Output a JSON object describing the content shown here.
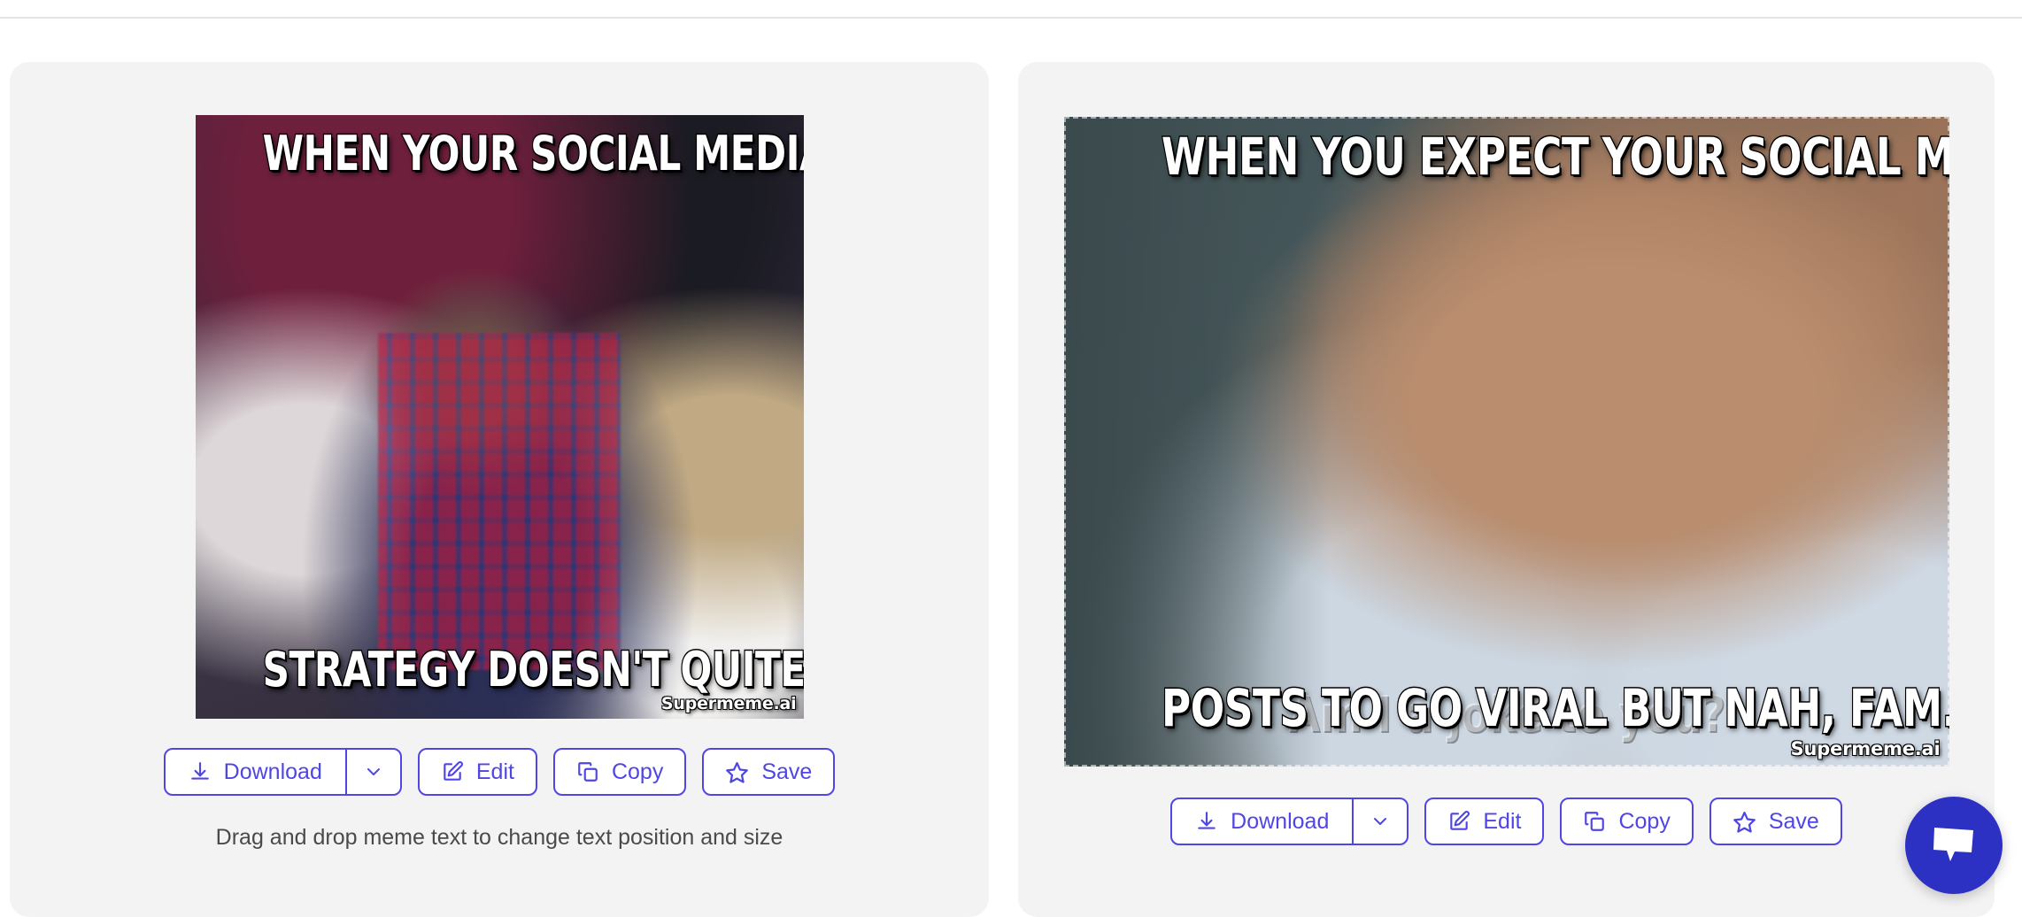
{
  "app": {
    "watermark": "Supermeme.ai",
    "accent_color": "#4f46e5",
    "chat_color": "#2c31c4",
    "card_background": "#f3f3f4",
    "page_background": "#ffffff"
  },
  "hint": {
    "text": "Drag and drop meme text to change text position and size"
  },
  "actions": {
    "download_label": "Download",
    "download_caret_label": "",
    "edit_label": "Edit",
    "copy_label": "Copy",
    "save_label": "Save"
  },
  "memes": [
    {
      "id": "meme-1",
      "top_text": "WHEN YOUR SOCIAL MEDIA",
      "bottom_text": "STRATEGY DOESN'T QUITE PAY OFF",
      "ghost_text": "",
      "watermark": "Supermeme.ai",
      "selected": false,
      "template": "disappointed-cricket-fan"
    },
    {
      "id": "meme-2",
      "top_text": "WHEN YOU EXPECT YOUR SOCIAL MEDIA",
      "bottom_text": "POSTS TO GO VIRAL BUT NAH, FAM.",
      "ghost_text": "Am I a joke to you?",
      "watermark": "Supermeme.ai",
      "selected": true,
      "template": "am-i-a-joke-to-you"
    }
  ],
  "chat": {
    "label": "chat-bubble-icon"
  }
}
